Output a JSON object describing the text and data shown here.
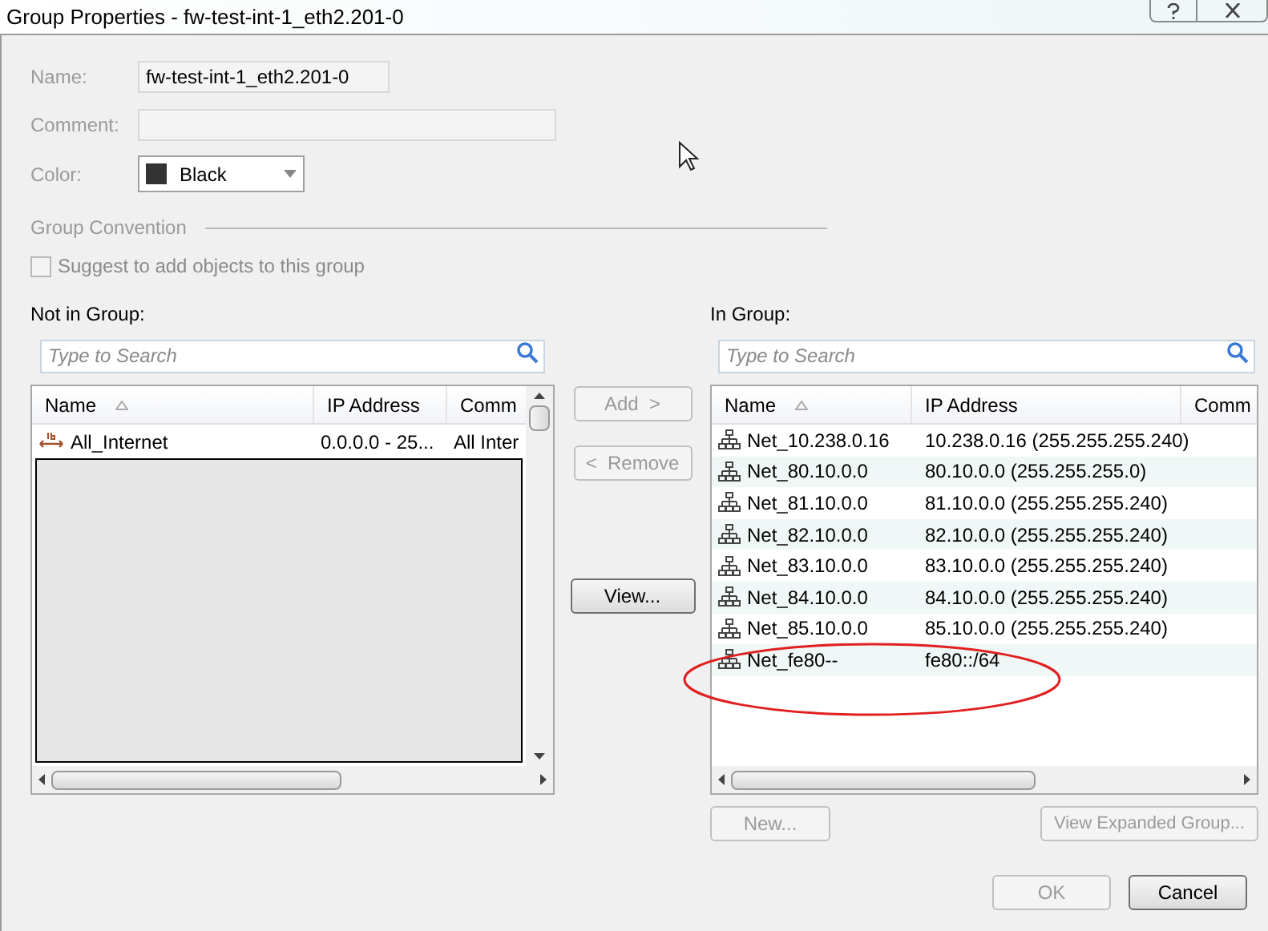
{
  "window": {
    "title": "Group Properties - fw-test-int-1_eth2.201-0"
  },
  "form": {
    "name_label": "Name:",
    "name_value": "fw-test-int-1_eth2.201-0",
    "comment_label": "Comment:",
    "color_label": "Color:",
    "color_value": "Black",
    "color": "#333333",
    "disabled": true
  },
  "group_convention": {
    "title": "Group Convention",
    "checkbox_label": "Suggest to add objects to this group",
    "checked": false,
    "disabled": true
  },
  "not_in_group": {
    "label": "Not in Group:",
    "search_placeholder": "Type to Search",
    "columns": [
      "Name",
      "IP Address",
      "Comm"
    ],
    "rows": [
      {
        "kind": "ip-range",
        "name": "All_Internet",
        "ip": "0.0.0.0 - 25...",
        "comment": "All Inter"
      }
    ],
    "redacted": true
  },
  "middle_buttons": [
    {
      "label": "Add  >",
      "disabled": true
    },
    {
      "label": "<  Remove",
      "disabled": true
    },
    {
      "label": "View...",
      "disabled": false
    }
  ],
  "in_group": {
    "label": "In Group:",
    "search_placeholder": "Type to Search",
    "columns": [
      "Name",
      "IP Address",
      "Comm"
    ],
    "rows": [
      {
        "kind": "network",
        "name": "Net_10.238.0.16",
        "ip": "10.238.0.16 (255.255.255.240)"
      },
      {
        "kind": "network",
        "name": "Net_80.10.0.0",
        "ip": "80.10.0.0 (255.255.255.0)"
      },
      {
        "kind": "network",
        "name": "Net_81.10.0.0",
        "ip": "81.10.0.0 (255.255.255.240)"
      },
      {
        "kind": "network",
        "name": "Net_82.10.0.0",
        "ip": "82.10.0.0 (255.255.255.240)"
      },
      {
        "kind": "network",
        "name": "Net_83.10.0.0",
        "ip": "83.10.0.0 (255.255.255.240)"
      },
      {
        "kind": "network",
        "name": "Net_84.10.0.0",
        "ip": "84.10.0.0 (255.255.255.240)"
      },
      {
        "kind": "network",
        "name": "Net_85.10.0.0",
        "ip": "85.10.0.0 (255.255.255.240)"
      },
      {
        "kind": "network",
        "name": "Net_fe80--",
        "ip": "fe80::/64"
      }
    ]
  },
  "in_group_buttons": [
    {
      "label": "New...",
      "disabled": true
    },
    {
      "label": "View Expanded Group...",
      "disabled": true
    }
  ],
  "footer_buttons": [
    {
      "label": "OK",
      "disabled": true
    },
    {
      "label": "Cancel",
      "disabled": false
    }
  ]
}
